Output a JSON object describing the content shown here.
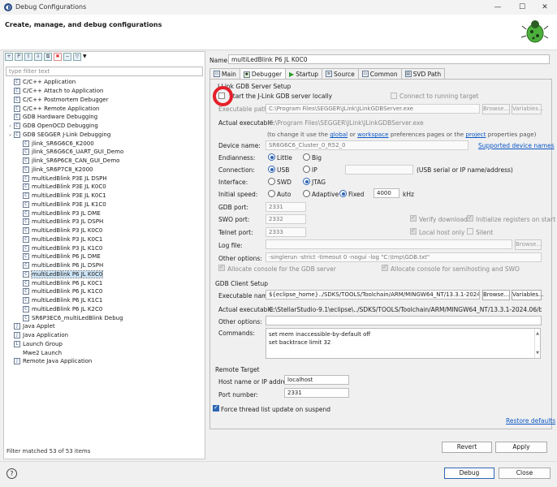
{
  "window": {
    "title": "Debug Configurations",
    "minimize": "—",
    "maximize": "☐",
    "close": "✕"
  },
  "header": {
    "title": "Create, manage, and debug configurations"
  },
  "sidebar": {
    "filter_placeholder": "type filter text",
    "items": [
      {
        "label": "C/C++ Application",
        "level": 1,
        "icon": "C"
      },
      {
        "label": "C/C++ Attach to Application",
        "level": 1,
        "icon": "C"
      },
      {
        "label": "C/C++ Postmortem Debugger",
        "level": 1,
        "icon": "C"
      },
      {
        "label": "C/C++ Remote Application",
        "level": 1,
        "icon": "C"
      },
      {
        "label": "GDB Hardware Debugging",
        "level": 1,
        "icon": "C"
      },
      {
        "label": "GDB OpenOCD Debugging",
        "level": 1,
        "icon": "C",
        "arrow": ">"
      },
      {
        "label": "GDB SEGGER J-Link Debugging",
        "level": 1,
        "icon": "C",
        "arrow": "v"
      },
      {
        "label": "jlink_SR6G6C6_K2000",
        "level": 2,
        "icon": "C"
      },
      {
        "label": "jlink_SR6G6C6_UART_GUI_Demo",
        "level": 2,
        "icon": "C"
      },
      {
        "label": "jlink_SR6P6C8_CAN_GUI_Demo",
        "level": 2,
        "icon": "C"
      },
      {
        "label": "jlink_SR6P7C8_K2000",
        "level": 2,
        "icon": "C"
      },
      {
        "label": "multiLedBlink P3E JL DSPH",
        "level": 2,
        "icon": "C"
      },
      {
        "label": "multiLedBlink P3E JL K0C0",
        "level": 2,
        "icon": "C"
      },
      {
        "label": "multiLedBlink P3E JL K0C1",
        "level": 2,
        "icon": "C"
      },
      {
        "label": "multiLedBlink P3E JL K1C0",
        "level": 2,
        "icon": "C"
      },
      {
        "label": "multiLedBlink P3 JL DME",
        "level": 2,
        "icon": "C"
      },
      {
        "label": "multiLedBlink P3 JL DSPH",
        "level": 2,
        "icon": "C"
      },
      {
        "label": "multiLedBlink P3 JL K0C0",
        "level": 2,
        "icon": "C"
      },
      {
        "label": "multiLedBlink P3 JL K0C1",
        "level": 2,
        "icon": "C"
      },
      {
        "label": "multiLedBlink P3 JL K1C0",
        "level": 2,
        "icon": "C"
      },
      {
        "label": "multiLedBlink P6 JL DME",
        "level": 2,
        "icon": "C"
      },
      {
        "label": "multiLedBlink P6 JL DSPH",
        "level": 2,
        "icon": "C"
      },
      {
        "label": "multiLedBlink P6 JL K0C0",
        "level": 2,
        "icon": "C",
        "selected": true
      },
      {
        "label": "multiLedBlink P6 JL K0C1",
        "level": 2,
        "icon": "C"
      },
      {
        "label": "multiLedBlink P6 JL K1C0",
        "level": 2,
        "icon": "C"
      },
      {
        "label": "multiLedBlink P6 JL K1C1",
        "level": 2,
        "icon": "C"
      },
      {
        "label": "multiLedBlink P6 JL K2C0",
        "level": 2,
        "icon": "C"
      },
      {
        "label": "SR6P3EC6_multiLedBlink Debug",
        "level": 2,
        "icon": "C"
      },
      {
        "label": "Java Applet",
        "level": 1,
        "icon": "J"
      },
      {
        "label": "Java Application",
        "level": 1,
        "icon": "J"
      },
      {
        "label": "Launch Group",
        "level": 1,
        "icon": "L"
      },
      {
        "label": "Mwe2 Launch",
        "level": 1,
        "icon": ""
      },
      {
        "label": "Remote Java Application",
        "level": 1,
        "icon": "J"
      }
    ],
    "status": "Filter matched 53 of 53 items"
  },
  "config": {
    "name_label": "Name:",
    "name_value": "multiLedBlink P6 JL K0C0",
    "tabs": [
      "Main",
      "Debugger",
      "Startup",
      "Source",
      "Common",
      "SVD Path"
    ],
    "active_tab": "Debugger"
  },
  "server": {
    "section": "J-Link GDB Server Setup",
    "start_locally": "Start the J-Link GDB server locally",
    "connect_running": "Connect to running target",
    "exec_path_label": "Executable path:",
    "exec_path_value": "C:\\Program Files\\SEGGER\\JLink\\JLinkGDBServer.exe",
    "browse": "Browse...",
    "variables": "Variables...",
    "actual_exec_label": "Actual executable:",
    "actual_exec_value": "C:\\Program Files\\SEGGER\\JLink\\JLinkGDBServer.exe",
    "hint_pre": "(to change it use the ",
    "hint_global": "global",
    "hint_or": " or ",
    "hint_workspace": "workspace",
    "hint_mid": " preferences pages or the ",
    "hint_project": "project",
    "hint_post": " properties page)",
    "device_label": "Device name:",
    "device_value": "SR6G6C6_Cluster_0_R52_0",
    "supported_devices": "Supported device names",
    "endianness_label": "Endianness:",
    "little": "Little",
    "big": "Big",
    "connection_label": "Connection:",
    "usb": "USB",
    "ip": "IP",
    "usb_hint": "(USB serial or IP name/address)",
    "interface_label": "Interface:",
    "swd": "SWD",
    "jtag": "JTAG",
    "speed_label": "Initial speed:",
    "auto": "Auto",
    "adaptive": "Adaptive",
    "fixed": "Fixed",
    "speed_value": "4000",
    "speed_unit": "kHz",
    "gdb_port_label": "GDB port:",
    "gdb_port": "2331",
    "swo_port_label": "SWO port:",
    "swo_port": "2332",
    "verify_downloads": "Verify downloads",
    "init_registers": "Initialize registers on start",
    "telnet_label": "Telnet port:",
    "telnet_port": "2333",
    "local_only": "Local host only",
    "silent": "Silent",
    "log_label": "Log file:",
    "log_browse": "Browse...",
    "other_label": "Other options:",
    "other_value": "-singlerun -strict -timeout 0 -nogui -log \"C:\\tmp\\GDB.txt\"",
    "alloc_console": "Allocate console for the GDB server",
    "alloc_semihost": "Allocate console for semihosting and SWO"
  },
  "client": {
    "section": "GDB Client Setup",
    "exec_label": "Executable name:",
    "exec_value": "${eclipse_home}../SDKS/TOOLS/Toolchain/ARM/MINGW64_NT/13.3.1-2024.06/bin/a",
    "browse": "Browse...",
    "variables": "Variables...",
    "actual_label": "Actual executable:",
    "actual_value": "C:\\StellarStudio-9.1\\eclipse\\../SDKS/TOOLS/Toolchain/ARM/MINGW64_NT/13.3.1-2024.06/bin/arm-none-eab",
    "other_label": "Other options:",
    "commands_label": "Commands:",
    "commands": [
      "set mem inaccessible-by-default off",
      "set backtrace limit 32"
    ]
  },
  "remote": {
    "section": "Remote Target",
    "host_label": "Host name or IP address:",
    "host_value": "localhost",
    "port_label": "Port number:",
    "port_value": "2331"
  },
  "force_thread": "Force thread list update on suspend",
  "restore_defaults": "Restore defaults",
  "buttons": {
    "revert": "Revert",
    "apply": "Apply",
    "debug": "Debug",
    "close": "Close",
    "help": "?"
  }
}
